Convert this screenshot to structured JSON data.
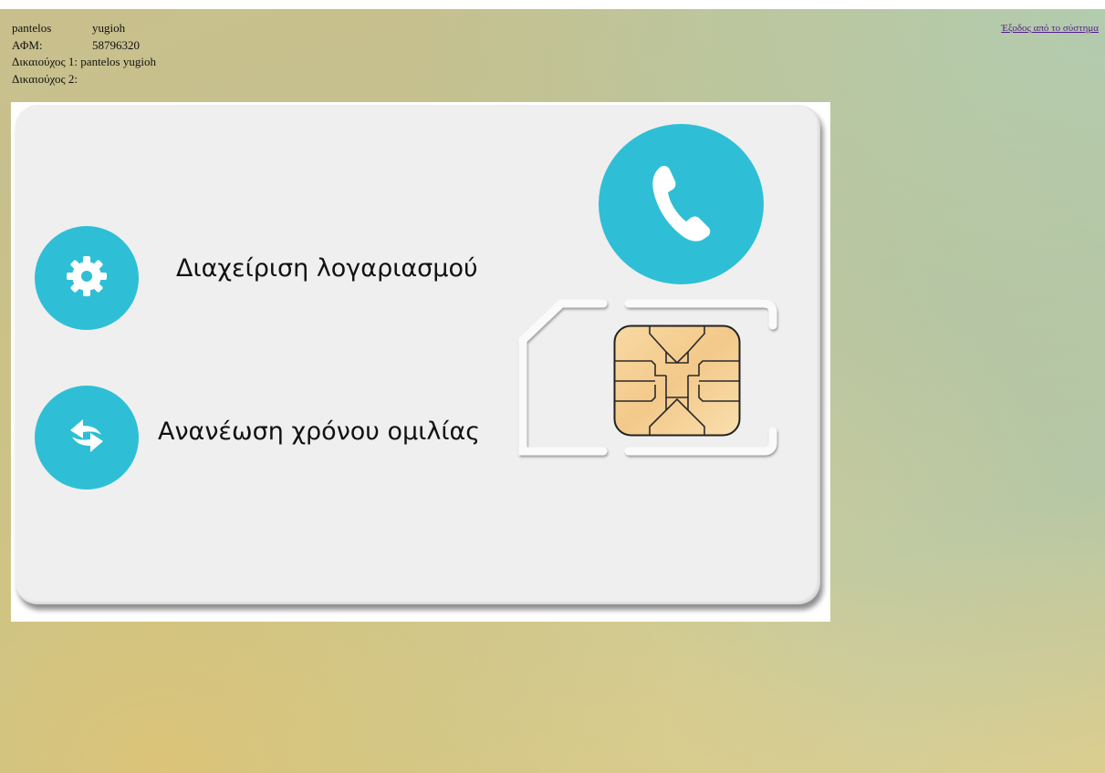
{
  "user": {
    "first_name": "pantelos",
    "last_name": "yugioh",
    "afm_label": "ΑΦΜ:",
    "afm_value": "58796320",
    "holder1_label": "Δικαιούχος 1:",
    "holder1_value": "pantelos yugioh",
    "holder2_label": "Δικαιούχος 2:",
    "holder2_value": ""
  },
  "header": {
    "logout_label": "Έξοδος από το σύστημα"
  },
  "menu": {
    "account_label": "Διαχείριση λογαριασμού",
    "renew_label": "Ανανέωση χρόνου ομιλίας"
  },
  "icons": {
    "account": "gear-icon",
    "renew": "refresh-icon",
    "call": "phone-icon",
    "sim": "sim-chip-icon"
  },
  "colors": {
    "accent": "#2ebfd6",
    "card": "#efefef",
    "chip": "#f6d49a",
    "link": "#551a8b"
  }
}
